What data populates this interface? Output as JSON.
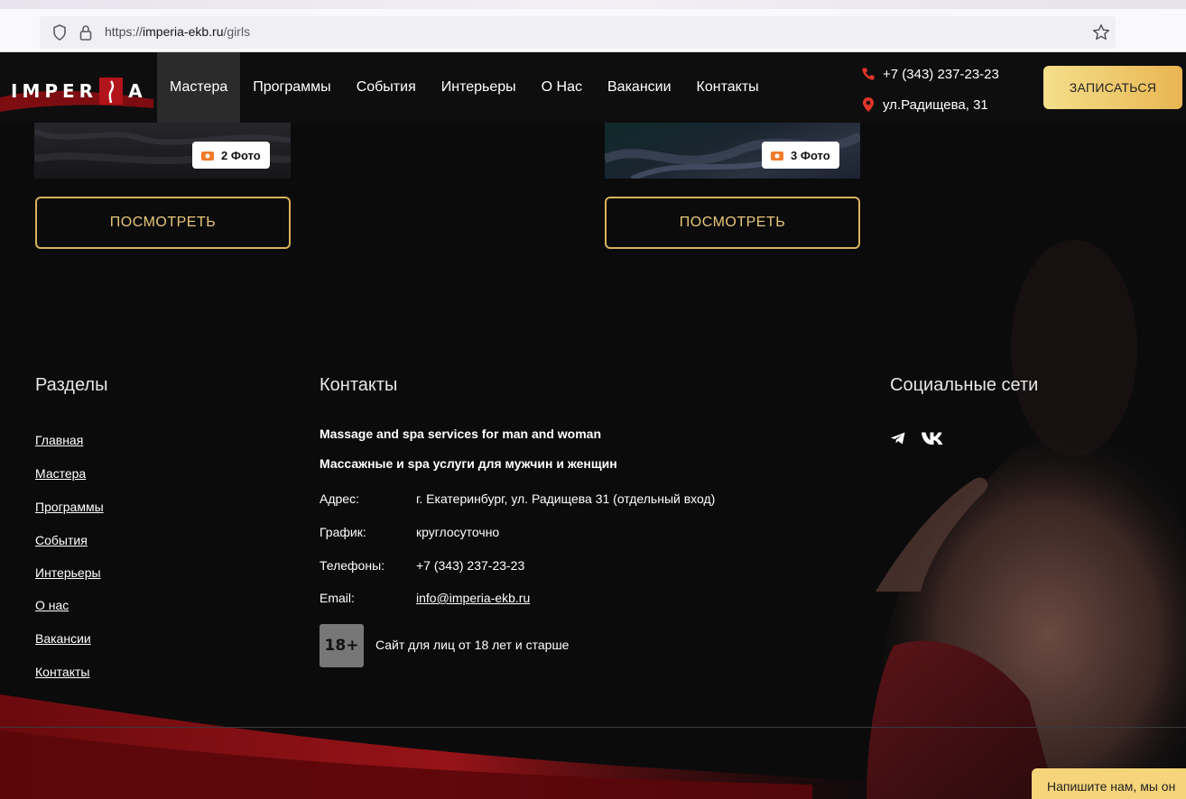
{
  "browser": {
    "url_prefix": "https://",
    "url_host": "imperia-ekb.ru",
    "url_path": "/girls"
  },
  "header": {
    "logo_left": "IMPER",
    "logo_right": "A",
    "nav": [
      {
        "label": "Мастера",
        "active": true
      },
      {
        "label": "Программы"
      },
      {
        "label": "События"
      },
      {
        "label": "Интерьеры"
      },
      {
        "label": "О Нас"
      },
      {
        "label": "Вакансии"
      },
      {
        "label": "Контакты"
      }
    ],
    "phone": "+7 (343) 237-23-23",
    "address": "ул.Радищева, 31",
    "cta_label": "ЗАПИСАТЬСЯ",
    "accent": "#e9b552"
  },
  "cards": [
    {
      "photos": "2 Фото",
      "button": "ПОСМОТРЕТЬ"
    },
    {
      "photos": "3 Фото",
      "button": "ПОСМОТРЕТЬ"
    }
  ],
  "footer": {
    "sections_title": "Разделы",
    "contacts_title": "Контакты",
    "social_title": "Социальные сети",
    "links": [
      "Главная",
      "Мастера",
      "Программы",
      "События",
      "Интерьеры",
      "О нас",
      "Вакансии",
      "Контакты"
    ],
    "tagline_en": "Massage and spa services for man and woman",
    "tagline_ru": "Массажные и spa услуги для мужчин и женщин",
    "info": [
      {
        "label": "Адрес:",
        "value": "г. Екатеринбург, ул. Радищева 31 (отдельный вход)"
      },
      {
        "label": "График:",
        "value": "круглосуточно"
      },
      {
        "label": "Телефоны:",
        "value": "+7 (343) 237-23-23"
      },
      {
        "label": "Email:",
        "value": "info@imperia-ekb.ru"
      }
    ],
    "age_badge": "18+",
    "age_text": "Сайт для лиц от 18 лет и старше",
    "social": [
      "telegram-icon",
      "vk-icon"
    ]
  },
  "chat": {
    "label": "Напишите нам, мы он"
  }
}
